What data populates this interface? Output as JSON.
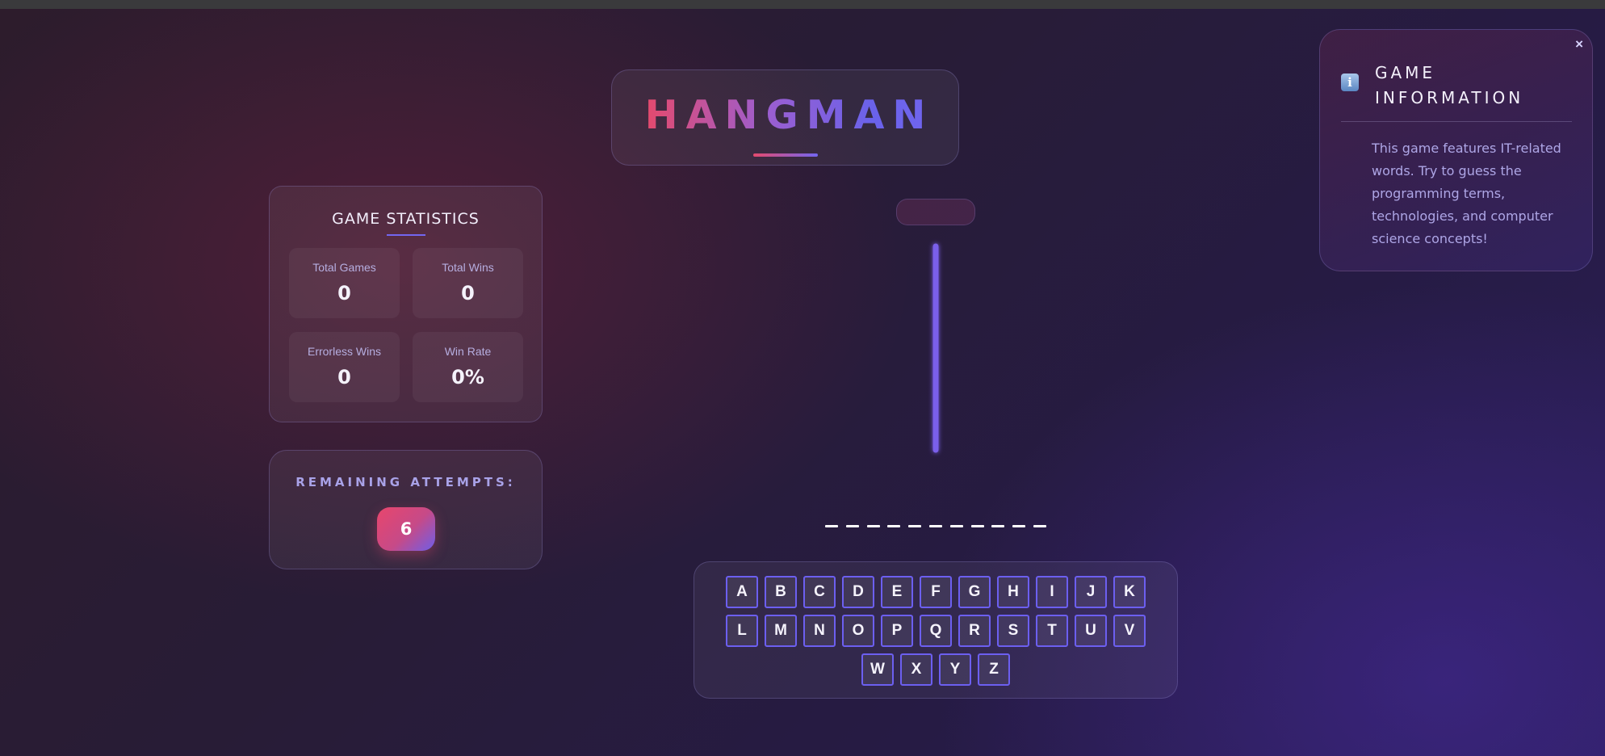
{
  "title": "HANGMAN",
  "stats": {
    "heading": "GAME STATISTICS",
    "items": [
      {
        "label": "Total Games",
        "value": "0"
      },
      {
        "label": "Total Wins",
        "value": "0"
      },
      {
        "label": "Errorless Wins",
        "value": "0"
      },
      {
        "label": "Win Rate",
        "value": "0%"
      }
    ]
  },
  "attempts": {
    "label": "REMAINING ATTEMPTS:",
    "value": "6"
  },
  "word": {
    "letter_count": 11
  },
  "keyboard": {
    "rows": [
      [
        "A",
        "B",
        "C",
        "D",
        "E",
        "F",
        "G",
        "H",
        "I",
        "J",
        "K"
      ],
      [
        "L",
        "M",
        "N",
        "O",
        "P",
        "Q",
        "R",
        "S",
        "T",
        "U",
        "V"
      ],
      [
        "W",
        "X",
        "Y",
        "Z"
      ]
    ]
  },
  "info": {
    "close": "×",
    "icon": "info-icon",
    "icon_glyph": "i",
    "title_line1": "GAME",
    "title_line2": "INFORMATION",
    "text": "This game features IT-related words. Try to guess the programming terms, technologies, and computer science concepts!"
  },
  "colors": {
    "accent": "#7366f0",
    "brand_pink": "#e44a6e",
    "gallows": "#7366f0"
  }
}
